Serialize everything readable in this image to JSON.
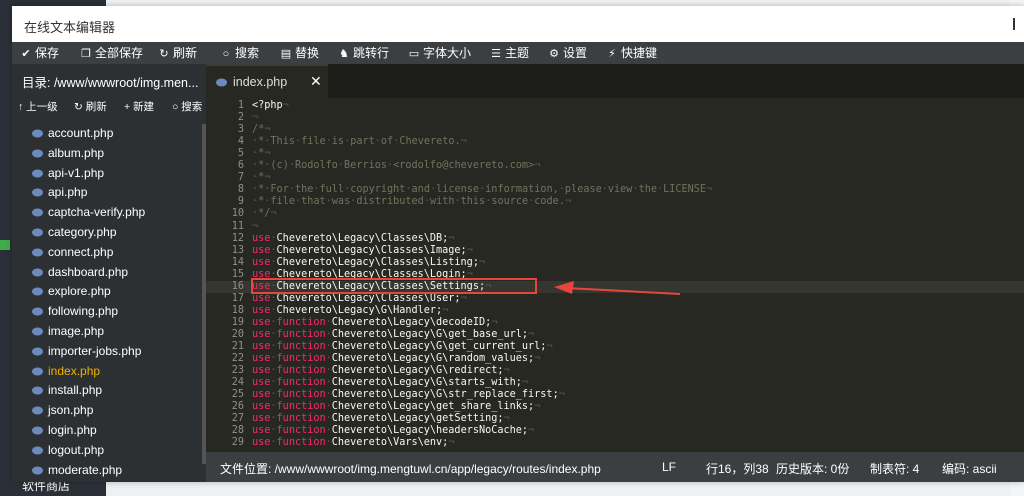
{
  "window": {
    "title": "在线文本编辑器"
  },
  "toolbar": {
    "save": "保存",
    "save_all": "全部保存",
    "refresh": "刷新",
    "search": "搜索",
    "replace": "替换",
    "goto_line": "跳转行",
    "font_size": "字体大小",
    "theme": "主题",
    "settings": "设置",
    "shortcuts": "快捷键"
  },
  "sidebar": {
    "directory": "目录: /www/wwwroot/img.men...",
    "actions": {
      "up": "上一级",
      "refresh": "刷新",
      "new": "新建",
      "search": "搜索"
    },
    "files": [
      "account.php",
      "album.php",
      "api-v1.php",
      "api.php",
      "captcha-verify.php",
      "category.php",
      "connect.php",
      "dashboard.php",
      "explore.php",
      "following.php",
      "image.php",
      "importer-jobs.php",
      "index.php",
      "install.php",
      "json.php",
      "login.php",
      "logout.php",
      "moderate.php"
    ],
    "active_file": "index.php"
  },
  "tab": {
    "name": "index.php",
    "close": "✕"
  },
  "code": {
    "line_numbers": [
      "1",
      "2",
      "3",
      "4",
      "5",
      "6",
      "7",
      "8",
      "9",
      "10",
      "11",
      "12",
      "13",
      "14",
      "15",
      "16",
      "17",
      "18",
      "19",
      "20",
      "21",
      "22",
      "23",
      "24",
      "25",
      "26",
      "27",
      "28",
      "29"
    ],
    "lines": [
      "<?php",
      "",
      "/*",
      " * This file is part of Chevereto.",
      " *",
      " * (c) Rodolfo Berrios <rodolfo@chevereto.com>",
      " *",
      " * For the full copyright and license information, please view the LICENSE",
      " * file that was distributed with this source code.",
      " */",
      "",
      "use Chevereto\\Legacy\\Classes\\DB;",
      "use Chevereto\\Legacy\\Classes\\Image;",
      "use Chevereto\\Legacy\\Classes\\Listing;",
      "use Chevereto\\Legacy\\Classes\\Login;",
      "use Chevereto\\Legacy\\Classes\\Settings;",
      "use Chevereto\\Legacy\\Classes\\User;",
      "use Chevereto\\Legacy\\G\\Handler;",
      "use function Chevereto\\Legacy\\decodeID;",
      "use function Chevereto\\Legacy\\G\\get_base_url;",
      "use function Chevereto\\Legacy\\G\\get_current_url;",
      "use function Chevereto\\Legacy\\G\\random_values;",
      "use function Chevereto\\Legacy\\G\\redirect;",
      "use function Chevereto\\Legacy\\G\\starts_with;",
      "use function Chevereto\\Legacy\\G\\str_replace_first;",
      "use function Chevereto\\Legacy\\get_share_links;",
      "use function Chevereto\\Legacy\\getSetting;",
      "use function Chevereto\\Legacy\\headersNoCache;",
      "use function Chevereto\\Vars\\env;"
    ],
    "active_line": 16
  },
  "status": {
    "file_path": "文件位置: /www/wwwroot/img.mengtuwl.cn/app/legacy/routes/index.php",
    "line_ending": "LF",
    "cursor": "行16，列38",
    "history": "历史版本: 0份",
    "tab_size": "制表符: 4",
    "encoding": "编码: ascii"
  },
  "footer": {
    "label": "软件商店"
  },
  "colors": {
    "keyword": "#f92672",
    "comment": "#75715e",
    "active_file": "#f0b100",
    "annotation": "#e8453c"
  }
}
